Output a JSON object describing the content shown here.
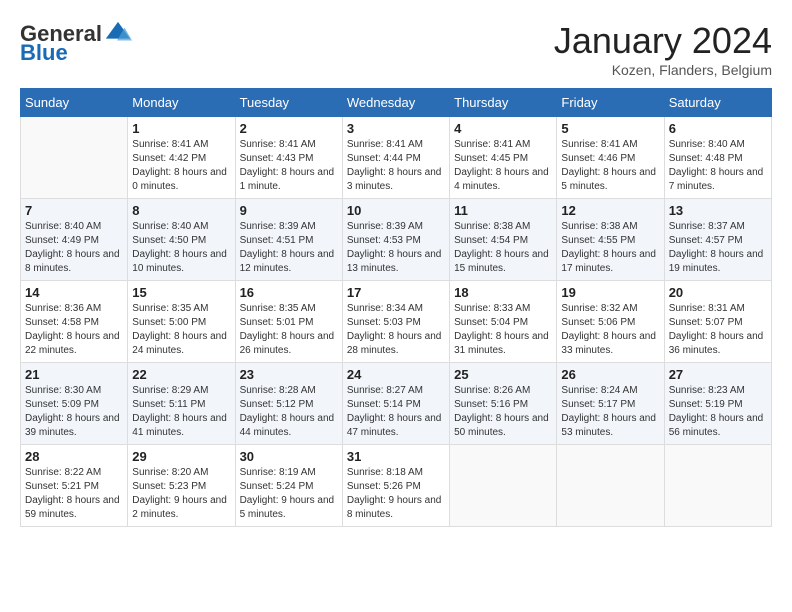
{
  "logo": {
    "general": "General",
    "blue": "Blue"
  },
  "header": {
    "month": "January 2024",
    "location": "Kozen, Flanders, Belgium"
  },
  "weekdays": [
    "Sunday",
    "Monday",
    "Tuesday",
    "Wednesday",
    "Thursday",
    "Friday",
    "Saturday"
  ],
  "weeks": [
    [
      {
        "day": "",
        "sunrise": "",
        "sunset": "",
        "daylight": ""
      },
      {
        "day": "1",
        "sunrise": "Sunrise: 8:41 AM",
        "sunset": "Sunset: 4:42 PM",
        "daylight": "Daylight: 8 hours and 0 minutes."
      },
      {
        "day": "2",
        "sunrise": "Sunrise: 8:41 AM",
        "sunset": "Sunset: 4:43 PM",
        "daylight": "Daylight: 8 hours and 1 minute."
      },
      {
        "day": "3",
        "sunrise": "Sunrise: 8:41 AM",
        "sunset": "Sunset: 4:44 PM",
        "daylight": "Daylight: 8 hours and 3 minutes."
      },
      {
        "day": "4",
        "sunrise": "Sunrise: 8:41 AM",
        "sunset": "Sunset: 4:45 PM",
        "daylight": "Daylight: 8 hours and 4 minutes."
      },
      {
        "day": "5",
        "sunrise": "Sunrise: 8:41 AM",
        "sunset": "Sunset: 4:46 PM",
        "daylight": "Daylight: 8 hours and 5 minutes."
      },
      {
        "day": "6",
        "sunrise": "Sunrise: 8:40 AM",
        "sunset": "Sunset: 4:48 PM",
        "daylight": "Daylight: 8 hours and 7 minutes."
      }
    ],
    [
      {
        "day": "7",
        "sunrise": "Sunrise: 8:40 AM",
        "sunset": "Sunset: 4:49 PM",
        "daylight": "Daylight: 8 hours and 8 minutes."
      },
      {
        "day": "8",
        "sunrise": "Sunrise: 8:40 AM",
        "sunset": "Sunset: 4:50 PM",
        "daylight": "Daylight: 8 hours and 10 minutes."
      },
      {
        "day": "9",
        "sunrise": "Sunrise: 8:39 AM",
        "sunset": "Sunset: 4:51 PM",
        "daylight": "Daylight: 8 hours and 12 minutes."
      },
      {
        "day": "10",
        "sunrise": "Sunrise: 8:39 AM",
        "sunset": "Sunset: 4:53 PM",
        "daylight": "Daylight: 8 hours and 13 minutes."
      },
      {
        "day": "11",
        "sunrise": "Sunrise: 8:38 AM",
        "sunset": "Sunset: 4:54 PM",
        "daylight": "Daylight: 8 hours and 15 minutes."
      },
      {
        "day": "12",
        "sunrise": "Sunrise: 8:38 AM",
        "sunset": "Sunset: 4:55 PM",
        "daylight": "Daylight: 8 hours and 17 minutes."
      },
      {
        "day": "13",
        "sunrise": "Sunrise: 8:37 AM",
        "sunset": "Sunset: 4:57 PM",
        "daylight": "Daylight: 8 hours and 19 minutes."
      }
    ],
    [
      {
        "day": "14",
        "sunrise": "Sunrise: 8:36 AM",
        "sunset": "Sunset: 4:58 PM",
        "daylight": "Daylight: 8 hours and 22 minutes."
      },
      {
        "day": "15",
        "sunrise": "Sunrise: 8:35 AM",
        "sunset": "Sunset: 5:00 PM",
        "daylight": "Daylight: 8 hours and 24 minutes."
      },
      {
        "day": "16",
        "sunrise": "Sunrise: 8:35 AM",
        "sunset": "Sunset: 5:01 PM",
        "daylight": "Daylight: 8 hours and 26 minutes."
      },
      {
        "day": "17",
        "sunrise": "Sunrise: 8:34 AM",
        "sunset": "Sunset: 5:03 PM",
        "daylight": "Daylight: 8 hours and 28 minutes."
      },
      {
        "day": "18",
        "sunrise": "Sunrise: 8:33 AM",
        "sunset": "Sunset: 5:04 PM",
        "daylight": "Daylight: 8 hours and 31 minutes."
      },
      {
        "day": "19",
        "sunrise": "Sunrise: 8:32 AM",
        "sunset": "Sunset: 5:06 PM",
        "daylight": "Daylight: 8 hours and 33 minutes."
      },
      {
        "day": "20",
        "sunrise": "Sunrise: 8:31 AM",
        "sunset": "Sunset: 5:07 PM",
        "daylight": "Daylight: 8 hours and 36 minutes."
      }
    ],
    [
      {
        "day": "21",
        "sunrise": "Sunrise: 8:30 AM",
        "sunset": "Sunset: 5:09 PM",
        "daylight": "Daylight: 8 hours and 39 minutes."
      },
      {
        "day": "22",
        "sunrise": "Sunrise: 8:29 AM",
        "sunset": "Sunset: 5:11 PM",
        "daylight": "Daylight: 8 hours and 41 minutes."
      },
      {
        "day": "23",
        "sunrise": "Sunrise: 8:28 AM",
        "sunset": "Sunset: 5:12 PM",
        "daylight": "Daylight: 8 hours and 44 minutes."
      },
      {
        "day": "24",
        "sunrise": "Sunrise: 8:27 AM",
        "sunset": "Sunset: 5:14 PM",
        "daylight": "Daylight: 8 hours and 47 minutes."
      },
      {
        "day": "25",
        "sunrise": "Sunrise: 8:26 AM",
        "sunset": "Sunset: 5:16 PM",
        "daylight": "Daylight: 8 hours and 50 minutes."
      },
      {
        "day": "26",
        "sunrise": "Sunrise: 8:24 AM",
        "sunset": "Sunset: 5:17 PM",
        "daylight": "Daylight: 8 hours and 53 minutes."
      },
      {
        "day": "27",
        "sunrise": "Sunrise: 8:23 AM",
        "sunset": "Sunset: 5:19 PM",
        "daylight": "Daylight: 8 hours and 56 minutes."
      }
    ],
    [
      {
        "day": "28",
        "sunrise": "Sunrise: 8:22 AM",
        "sunset": "Sunset: 5:21 PM",
        "daylight": "Daylight: 8 hours and 59 minutes."
      },
      {
        "day": "29",
        "sunrise": "Sunrise: 8:20 AM",
        "sunset": "Sunset: 5:23 PM",
        "daylight": "Daylight: 9 hours and 2 minutes."
      },
      {
        "day": "30",
        "sunrise": "Sunrise: 8:19 AM",
        "sunset": "Sunset: 5:24 PM",
        "daylight": "Daylight: 9 hours and 5 minutes."
      },
      {
        "day": "31",
        "sunrise": "Sunrise: 8:18 AM",
        "sunset": "Sunset: 5:26 PM",
        "daylight": "Daylight: 9 hours and 8 minutes."
      },
      {
        "day": "",
        "sunrise": "",
        "sunset": "",
        "daylight": ""
      },
      {
        "day": "",
        "sunrise": "",
        "sunset": "",
        "daylight": ""
      },
      {
        "day": "",
        "sunrise": "",
        "sunset": "",
        "daylight": ""
      }
    ]
  ]
}
